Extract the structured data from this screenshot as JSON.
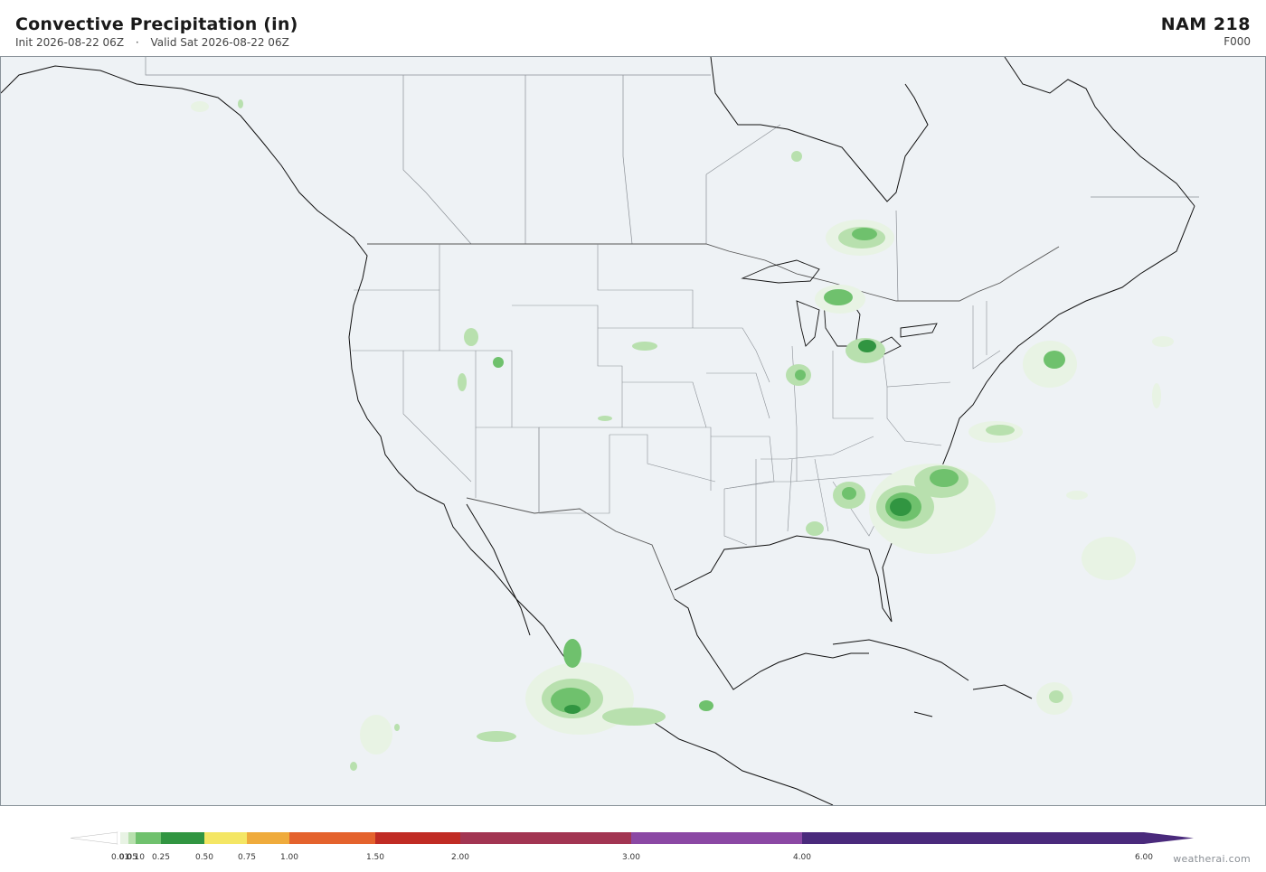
{
  "header": {
    "title": "Convective Precipitation  (in)",
    "init": "Init 2026-08-22 06Z",
    "separator": "·",
    "valid": "Valid Sat 2026-08-22 06Z",
    "model": "NAM  218",
    "forecast_hour": "F000"
  },
  "map": {
    "background_color": "#eef2f5",
    "coastline_color": "#111111",
    "boundary_color": "#8a8f95"
  },
  "colorbar": {
    "unit": "in",
    "bins": [
      {
        "from": 0.0,
        "to": 0.01,
        "color": "#ffffff"
      },
      {
        "from": 0.01,
        "to": 0.05,
        "color": "#e8f3e4"
      },
      {
        "from": 0.05,
        "to": 0.1,
        "color": "#b8e0ae"
      },
      {
        "from": 0.1,
        "to": 0.25,
        "color": "#6fc16d"
      },
      {
        "from": 0.25,
        "to": 0.5,
        "color": "#319541"
      },
      {
        "from": 0.5,
        "to": 0.75,
        "color": "#f4e664"
      },
      {
        "from": 0.75,
        "to": 1.0,
        "color": "#efab3c"
      },
      {
        "from": 1.0,
        "to": 1.5,
        "color": "#e4622d"
      },
      {
        "from": 1.5,
        "to": 2.0,
        "color": "#c02b24"
      },
      {
        "from": 2.0,
        "to": 3.0,
        "color": "#a23552"
      },
      {
        "from": 3.0,
        "to": 4.0,
        "color": "#8b48a4"
      },
      {
        "from": 4.0,
        "to": 6.0,
        "color": "#4a2a7c"
      }
    ],
    "tick_labels": [
      "0.01",
      "0.05",
      "0.10",
      "0.25",
      "0.50",
      "0.75",
      "1.00",
      "1.50",
      "2.00",
      "3.00",
      "4.00",
      "6.00"
    ],
    "tick_values": [
      0.01,
      0.05,
      0.1,
      0.25,
      0.5,
      0.75,
      1.0,
      1.5,
      2.0,
      3.0,
      4.0,
      6.0
    ]
  },
  "footer": {
    "credit": "weatherai.com"
  }
}
